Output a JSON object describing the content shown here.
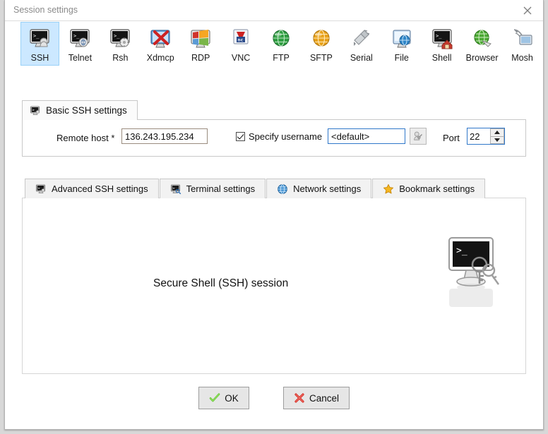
{
  "window": {
    "title": "Session settings",
    "close_label": "×",
    "close_icon": "close-icon"
  },
  "toolbar": {
    "items": [
      {
        "label": "SSH",
        "icon": "ssh-icon",
        "selected": true
      },
      {
        "label": "Telnet",
        "icon": "telnet-icon",
        "selected": false
      },
      {
        "label": "Rsh",
        "icon": "rsh-icon",
        "selected": false
      },
      {
        "label": "Xdmcp",
        "icon": "xdmcp-icon",
        "selected": false
      },
      {
        "label": "RDP",
        "icon": "rdp-icon",
        "selected": false
      },
      {
        "label": "VNC",
        "icon": "vnc-icon",
        "selected": false
      },
      {
        "label": "FTP",
        "icon": "ftp-icon",
        "selected": false
      },
      {
        "label": "SFTP",
        "icon": "sftp-icon",
        "selected": false
      },
      {
        "label": "Serial",
        "icon": "serial-icon",
        "selected": false
      },
      {
        "label": "File",
        "icon": "file-icon",
        "selected": false
      },
      {
        "label": "Shell",
        "icon": "shell-icon",
        "selected": false
      },
      {
        "label": "Browser",
        "icon": "browser-icon",
        "selected": false
      },
      {
        "label": "Mosh",
        "icon": "mosh-icon",
        "selected": false
      }
    ]
  },
  "basic_settings": {
    "tab_label": "Basic SSH settings",
    "tab_icon": "monitor-icon",
    "remote_host_label": "Remote host *",
    "remote_host_value": "136.243.195.234",
    "remote_host_placeholder": "",
    "specify_username_label": "Specify username",
    "specify_username_checked": true,
    "username_value": "<default>",
    "username_placeholder": "",
    "username_browse_icon": "user-key-icon",
    "port_label": "Port",
    "port_value": "22",
    "spinner_up_icon": "chevron-up-icon",
    "spinner_down_icon": "chevron-down-icon"
  },
  "lower_tabs": [
    {
      "label": "Advanced SSH settings",
      "icon": "monitor-icon"
    },
    {
      "label": "Terminal settings",
      "icon": "terminal-wrench-icon"
    },
    {
      "label": "Network settings",
      "icon": "globe-icon"
    },
    {
      "label": "Bookmark settings",
      "icon": "star-icon"
    }
  ],
  "content": {
    "caption": "Secure Shell (SSH) session",
    "art_icon": "ssh-monitor-keys-icon"
  },
  "buttons": [
    {
      "label": "OK",
      "icon": "green-check-icon"
    },
    {
      "label": "Cancel",
      "icon": "red-x-icon"
    }
  ],
  "colors": {
    "selection_blue": "#cce8ff",
    "selection_border": "#99d1f7",
    "field_border_blue": "#2f77c9",
    "field_border_host": "#9a8c7e",
    "ok_green": "#5fc12e",
    "cancel_red": "#d8342c",
    "window_bg": "#ffffff",
    "page_bg": "#d8d8d8"
  }
}
